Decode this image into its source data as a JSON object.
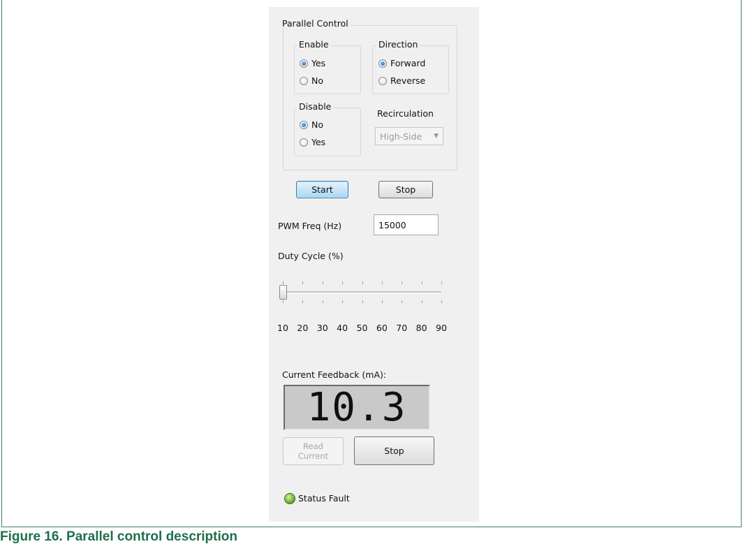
{
  "panel": {
    "parallel_control": {
      "title": "Parallel Control",
      "enable": {
        "title": "Enable",
        "options": [
          "Yes",
          "No"
        ],
        "selected": "Yes"
      },
      "direction": {
        "title": "Direction",
        "options": [
          "Forward",
          "Reverse"
        ],
        "selected": "Forward"
      },
      "disable": {
        "title": "Disable",
        "options": [
          "No",
          "Yes"
        ],
        "selected": "No"
      },
      "recirculation": {
        "title": "Recirculation",
        "value": "High-Side"
      }
    },
    "buttons": {
      "start": "Start",
      "stop": "Stop"
    },
    "pwm": {
      "label": "PWM Freq (Hz)",
      "value": "15000"
    },
    "duty": {
      "label": "Duty Cycle (%)",
      "ticks": [
        "10",
        "20",
        "30",
        "40",
        "50",
        "60",
        "70",
        "80",
        "90"
      ],
      "value": 10
    },
    "current": {
      "label": "Current Feedback (mA):",
      "display": "10.3",
      "read_line1": "Read",
      "read_line2": "Current",
      "stop": "Stop"
    },
    "status": {
      "label": "Status Fault",
      "color": "#5fa32a"
    }
  },
  "caption": "Figure 16.  Parallel control description"
}
